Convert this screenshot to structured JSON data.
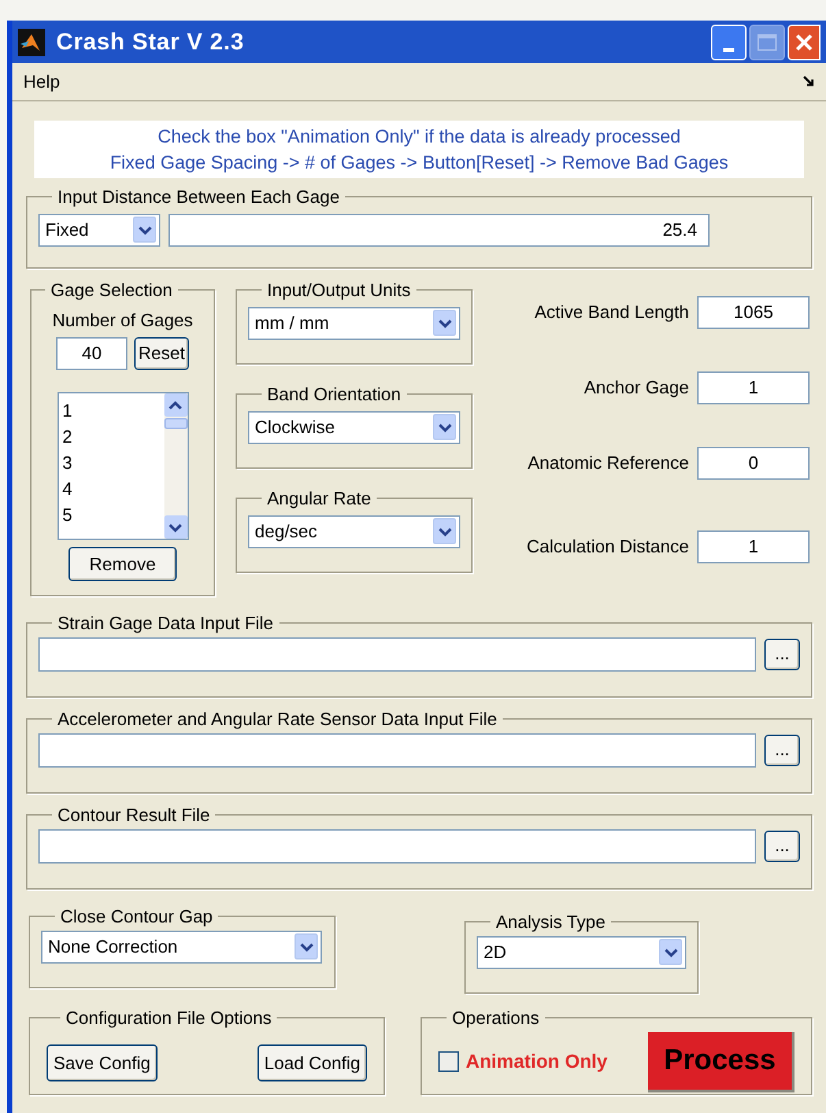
{
  "window": {
    "title": "Crash Star V 2.3"
  },
  "menu": [
    "Help"
  ],
  "info_lines": [
    "Check the box \"Animation Only\" if the data is already processed",
    "Fixed Gage Spacing -> # of Gages -> Button[Reset] -> Remove Bad Gages"
  ],
  "input_distance": {
    "label": "Input Distance Between Each Gage",
    "mode": "Fixed",
    "value": "25.4"
  },
  "gage_selection": {
    "label": "Gage Selection",
    "count_label": "Number of Gages",
    "count": "40",
    "reset_button": "Reset",
    "gages": [
      "1",
      "2",
      "3",
      "4",
      "5"
    ],
    "remove_button": "Remove"
  },
  "dropdowns": [
    {
      "label": "Input/Output Units",
      "value": "mm / mm"
    },
    {
      "label": "Band Orientation",
      "value": "Clockwise"
    },
    {
      "label": "Angular Rate",
      "value": "deg/sec"
    }
  ],
  "parameters": [
    {
      "label": "Active Band Length",
      "value": "1065"
    },
    {
      "label": "Anchor Gage",
      "value": "1"
    },
    {
      "label": "Anatomic Reference",
      "value": "0"
    },
    {
      "label": "Calculation Distance",
      "value": "1"
    }
  ],
  "files": [
    {
      "label": "Strain Gage Data Input File",
      "browse_button": "..."
    },
    {
      "label": "Accelerometer and Angular Rate Sensor Data Input File",
      "browse_button": "..."
    },
    {
      "label": "Contour Result File",
      "browse_button": "..."
    }
  ],
  "close_contour_gap": {
    "label": "Close Contour Gap",
    "value": "None Correction"
  },
  "analysis_type": {
    "label": "Analysis Type",
    "value": "2D"
  },
  "config": {
    "label": "Configuration File Options",
    "buttons": [
      "Save Config",
      "Load Config"
    ]
  },
  "operations": {
    "label": "Operations",
    "animation_only": {
      "label": "Animation Only",
      "checked": false
    },
    "process_button": "Process"
  }
}
